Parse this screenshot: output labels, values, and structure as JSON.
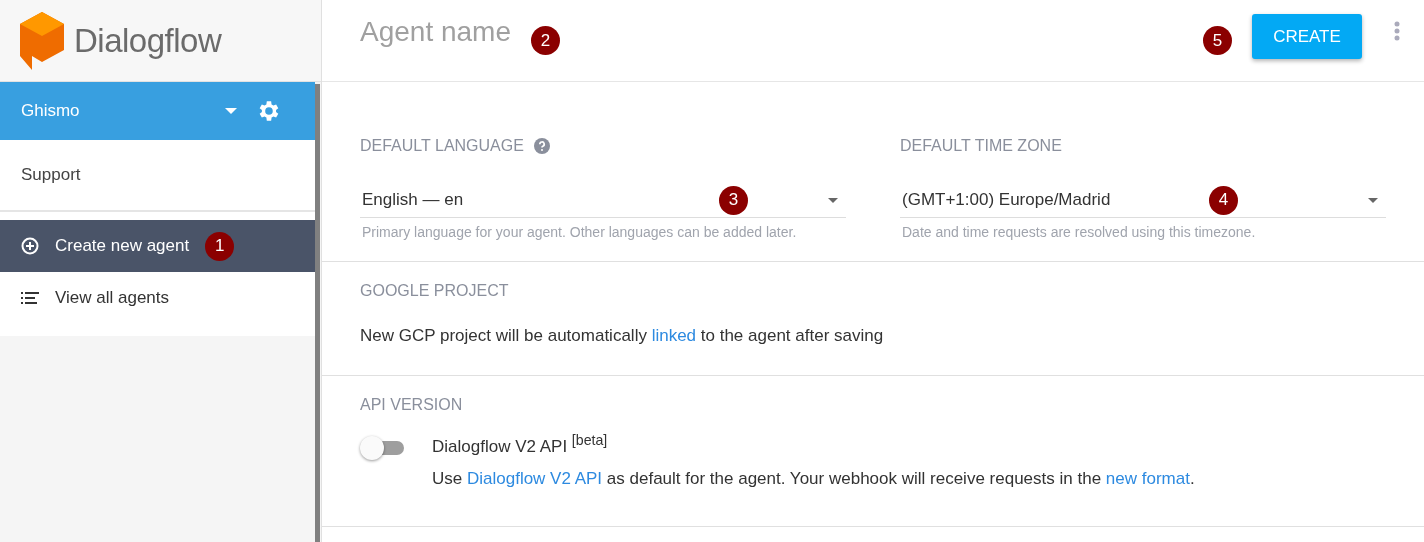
{
  "logo": {
    "text": "Dialogflow"
  },
  "sidebar": {
    "agent": "Ghismo",
    "support": "Support",
    "items": [
      {
        "label": "Create new agent",
        "kind": "add",
        "selected": true,
        "badge": "1"
      },
      {
        "label": "View all agents",
        "kind": "list",
        "selected": false
      }
    ]
  },
  "header": {
    "agent_name_placeholder": "Agent name",
    "badge": "2",
    "create_button": "CREATE",
    "create_badge": "5"
  },
  "language": {
    "label": "DEFAULT LANGUAGE",
    "value": "English — en",
    "badge": "3",
    "hint": "Primary language for your agent. Other languages can be added later."
  },
  "time_zone": {
    "label": "DEFAULT TIME ZONE",
    "value": "(GMT+1:00) Europe/Madrid",
    "badge": "4",
    "hint": "Date and time requests are resolved using this timezone."
  },
  "google_project": {
    "label": "GOOGLE PROJECT",
    "text": [
      {
        "kind": "text",
        "text": "New GCP project will be automatically "
      },
      {
        "kind": "link",
        "text": "linked"
      },
      {
        "kind": "text",
        "text": " to the agent after saving"
      }
    ]
  },
  "api_version": {
    "label": "API VERSION",
    "toggle_label": "Dialogflow V2 API $^{[beta]}$",
    "on": false,
    "text": [
      {
        "kind": "text",
        "text": "Use "
      },
      {
        "kind": "link",
        "text": "Dialogflow V2 API"
      },
      {
        "kind": "text",
        "text": " as default for the agent. Your webhook will receive requests in the "
      },
      {
        "kind": "link",
        "text": "new format"
      },
      {
        "kind": "text",
        "text": "."
      }
    ]
  }
}
